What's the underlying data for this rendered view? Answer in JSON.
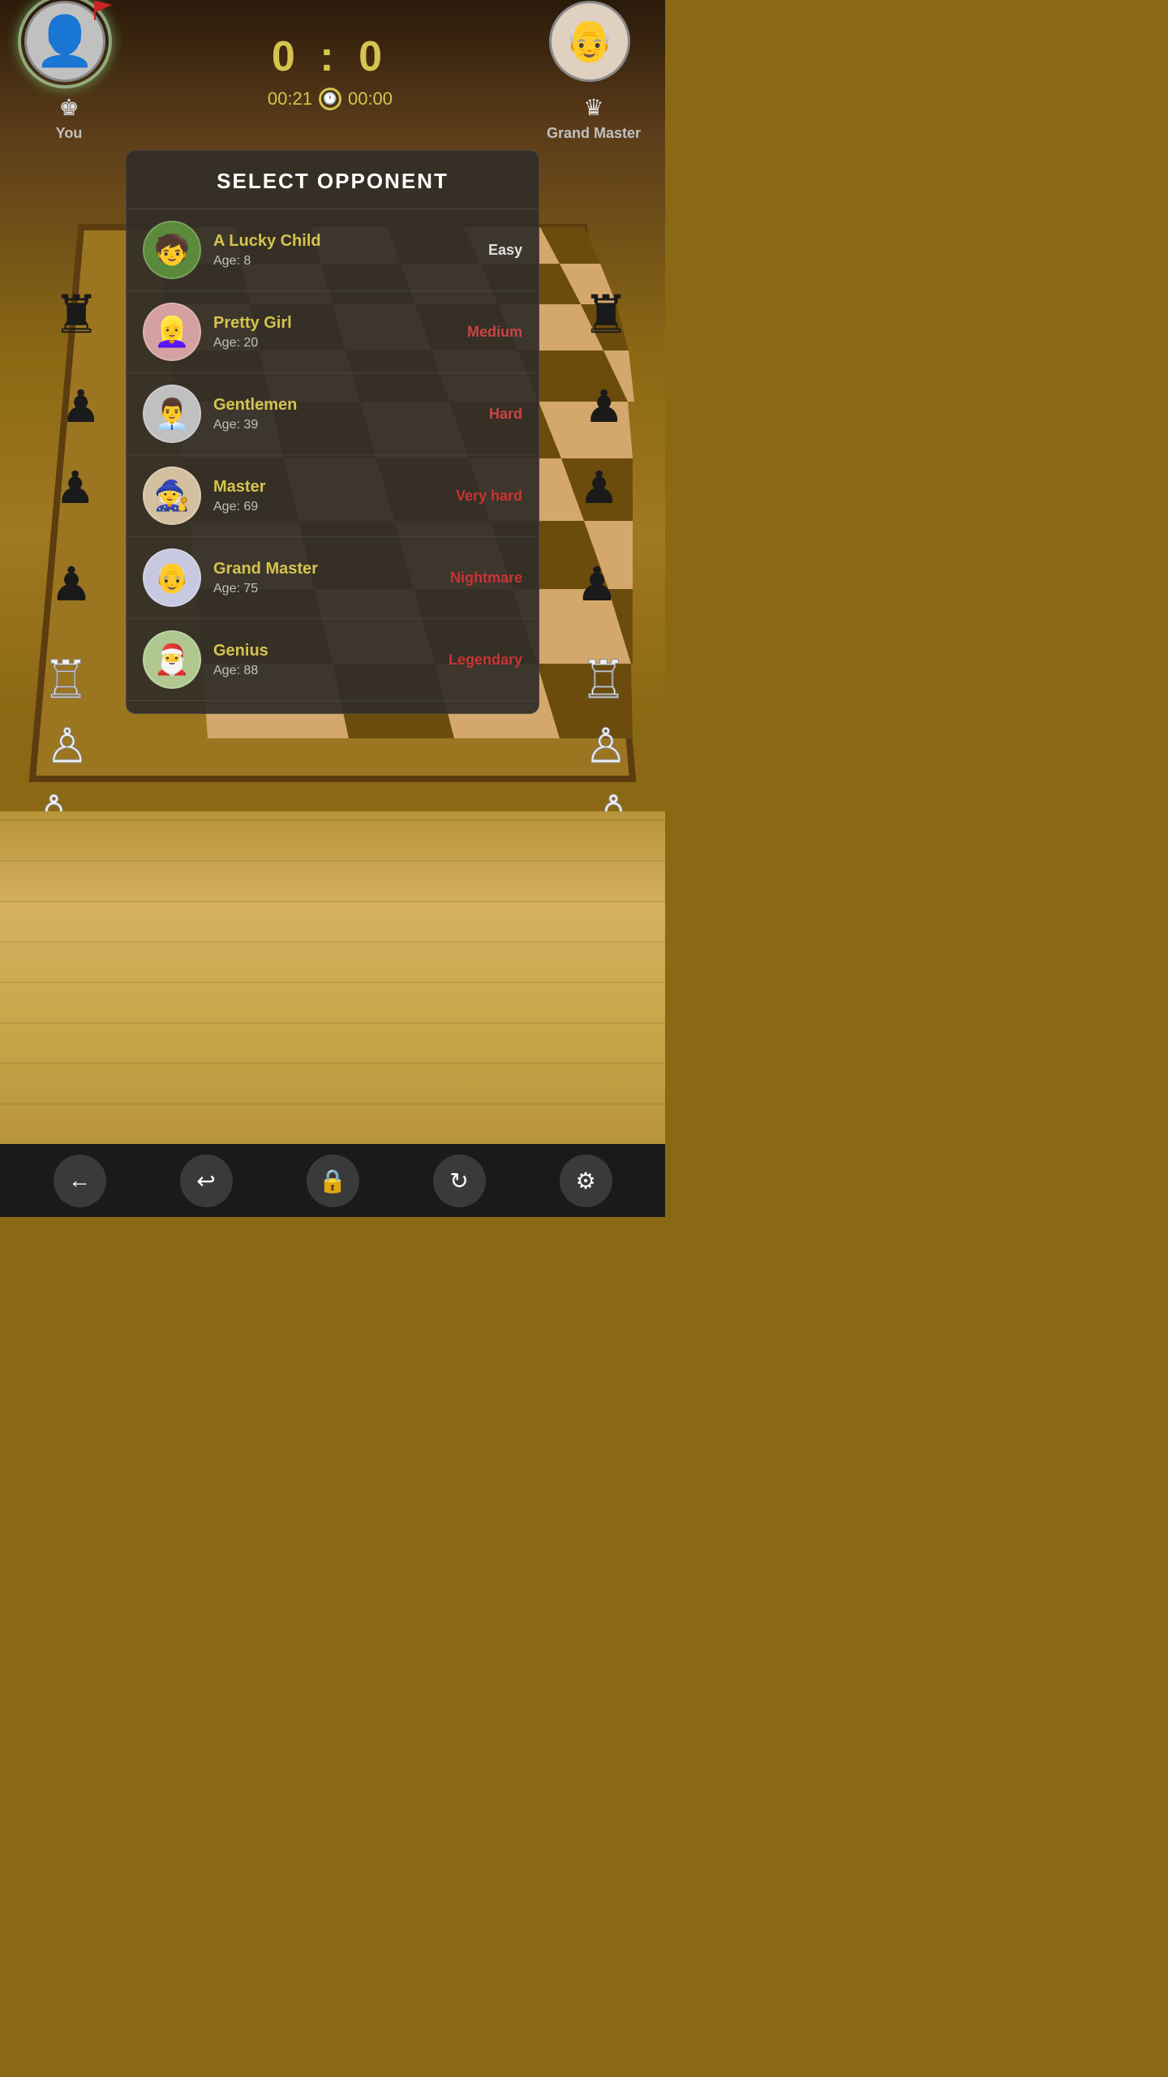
{
  "header": {
    "player_label": "You",
    "score_left": "0",
    "score_separator": ":",
    "score_right": "0",
    "timer_left": "00:21",
    "timer_right": "00:00",
    "opponent_label": "Grand Master"
  },
  "modal": {
    "title": "SELECT OPPONENT",
    "opponents": [
      {
        "id": "lucky-child",
        "name": "A Lucky Child",
        "age_label": "Age: 8",
        "difficulty": "Easy",
        "diff_class": "diff-easy",
        "emoji": "🧒",
        "bg": "#5a8a3a"
      },
      {
        "id": "pretty-girl",
        "name": "Pretty Girl",
        "age_label": "Age: 20",
        "difficulty": "Medium",
        "diff_class": "diff-medium",
        "emoji": "👱‍♀️",
        "bg": "#d4a0a0"
      },
      {
        "id": "gentlemen",
        "name": "Gentlemen",
        "age_label": "Age: 39",
        "difficulty": "Hard",
        "diff_class": "diff-hard",
        "emoji": "👨‍💼",
        "bg": "#c0c0c0"
      },
      {
        "id": "master",
        "name": "Master",
        "age_label": "Age: 69",
        "difficulty": "Very hard",
        "diff_class": "diff-veryhard",
        "emoji": "🧙",
        "bg": "#d4c0a0"
      },
      {
        "id": "grand-master",
        "name": "Grand Master",
        "age_label": "Age: 75",
        "difficulty": "Nightmare",
        "diff_class": "diff-nightmare",
        "emoji": "👴",
        "bg": "#c8c8e0"
      },
      {
        "id": "genius",
        "name": "Genius",
        "age_label": "Age: 88",
        "difficulty": "Legendary",
        "diff_class": "diff-legendary",
        "emoji": "🎅",
        "bg": "#b0c890"
      }
    ]
  },
  "toolbar": {
    "back_icon": "←",
    "undo_icon": "↩",
    "lock_icon": "🔒",
    "refresh_icon": "↻",
    "settings_icon": "⚙"
  }
}
